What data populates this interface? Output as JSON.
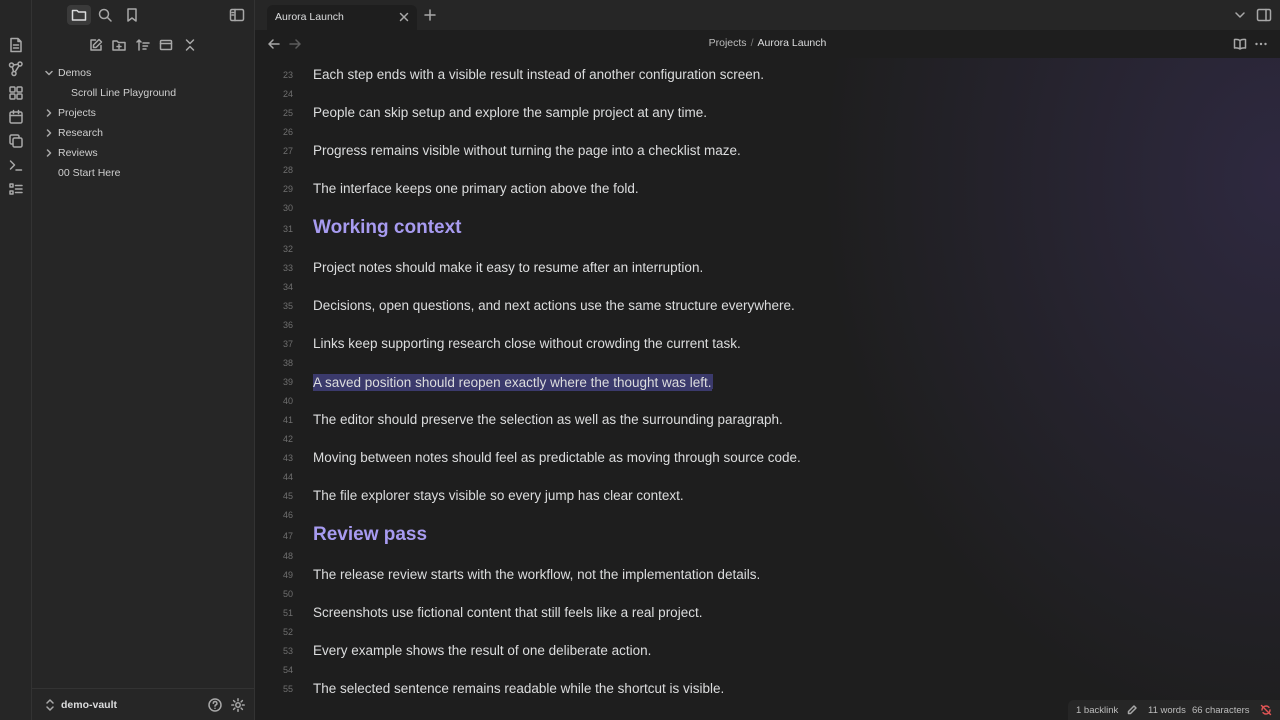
{
  "ribbon": {
    "icons": [
      "daily-note-icon",
      "graph-icon",
      "canvas-icon",
      "calendar-icon",
      "copy-icon",
      "terminal-icon",
      "checklist-icon"
    ]
  },
  "sidebar": {
    "top_icons": [
      "folder-icon",
      "search-icon",
      "bookmark-icon"
    ],
    "toggle_icon": "sidebar-toggle-icon",
    "nav_icons": [
      "new-note-icon",
      "new-folder-icon",
      "sort-icon",
      "collapse-icon",
      "close-icon"
    ],
    "tree": [
      {
        "label": "Demos",
        "expanded": true,
        "folder": true
      },
      {
        "label": "Scroll Line Playground",
        "child": true
      },
      {
        "label": "Projects",
        "expanded": false,
        "folder": true
      },
      {
        "label": "Research",
        "expanded": false,
        "folder": true
      },
      {
        "label": "Reviews",
        "expanded": false,
        "folder": true
      },
      {
        "label": "00 Start Here",
        "folder": false
      }
    ],
    "vault_name": "demo-vault"
  },
  "tab": {
    "title": "Aurora Launch"
  },
  "breadcrumb": {
    "parent": "Projects",
    "separator": "/",
    "current": "Aurora Launch"
  },
  "editor": {
    "lines": [
      {
        "n": "23",
        "text": "Each step ends with a visible result instead of another configuration screen."
      },
      {
        "n": "24",
        "text": ""
      },
      {
        "n": "25",
        "text": "People can skip setup and explore the sample project at any time."
      },
      {
        "n": "26",
        "text": ""
      },
      {
        "n": "27",
        "text": "Progress remains visible without turning the page into a checklist maze."
      },
      {
        "n": "28",
        "text": ""
      },
      {
        "n": "29",
        "text": "The interface keeps one primary action above the fold."
      },
      {
        "n": "30",
        "text": ""
      },
      {
        "n": "31",
        "text": "Working context",
        "heading": true
      },
      {
        "n": "32",
        "text": ""
      },
      {
        "n": "33",
        "text": "Project notes should make it easy to resume after an interruption."
      },
      {
        "n": "34",
        "text": ""
      },
      {
        "n": "35",
        "text": "Decisions, open questions, and next actions use the same structure everywhere."
      },
      {
        "n": "36",
        "text": ""
      },
      {
        "n": "37",
        "text": "Links keep supporting research close without crowding the current task."
      },
      {
        "n": "38",
        "text": ""
      },
      {
        "n": "39",
        "text": "A saved position should reopen exactly where the thought was left.",
        "selected": true
      },
      {
        "n": "40",
        "text": ""
      },
      {
        "n": "41",
        "text": "The editor should preserve the selection as well as the surrounding paragraph."
      },
      {
        "n": "42",
        "text": ""
      },
      {
        "n": "43",
        "text": "Moving between notes should feel as predictable as moving through source code."
      },
      {
        "n": "44",
        "text": ""
      },
      {
        "n": "45",
        "text": "The file explorer stays visible so every jump has clear context."
      },
      {
        "n": "46",
        "text": ""
      },
      {
        "n": "47",
        "text": "Review pass",
        "heading": true
      },
      {
        "n": "48",
        "text": ""
      },
      {
        "n": "49",
        "text": "The release review starts with the workflow, not the implementation details."
      },
      {
        "n": "50",
        "text": ""
      },
      {
        "n": "51",
        "text": "Screenshots use fictional content that still feels like a real project."
      },
      {
        "n": "52",
        "text": ""
      },
      {
        "n": "53",
        "text": "Every example shows the result of one deliberate action."
      },
      {
        "n": "54",
        "text": ""
      },
      {
        "n": "55",
        "text": "The selected sentence remains readable while the shortcut is visible."
      }
    ]
  },
  "status": {
    "backlinks": "1 backlink",
    "words": "11 words",
    "characters": "66 characters"
  },
  "colors": {
    "heading": "#a79bf0",
    "selection": "#3b3a6c",
    "sync_error": "#e05555"
  }
}
